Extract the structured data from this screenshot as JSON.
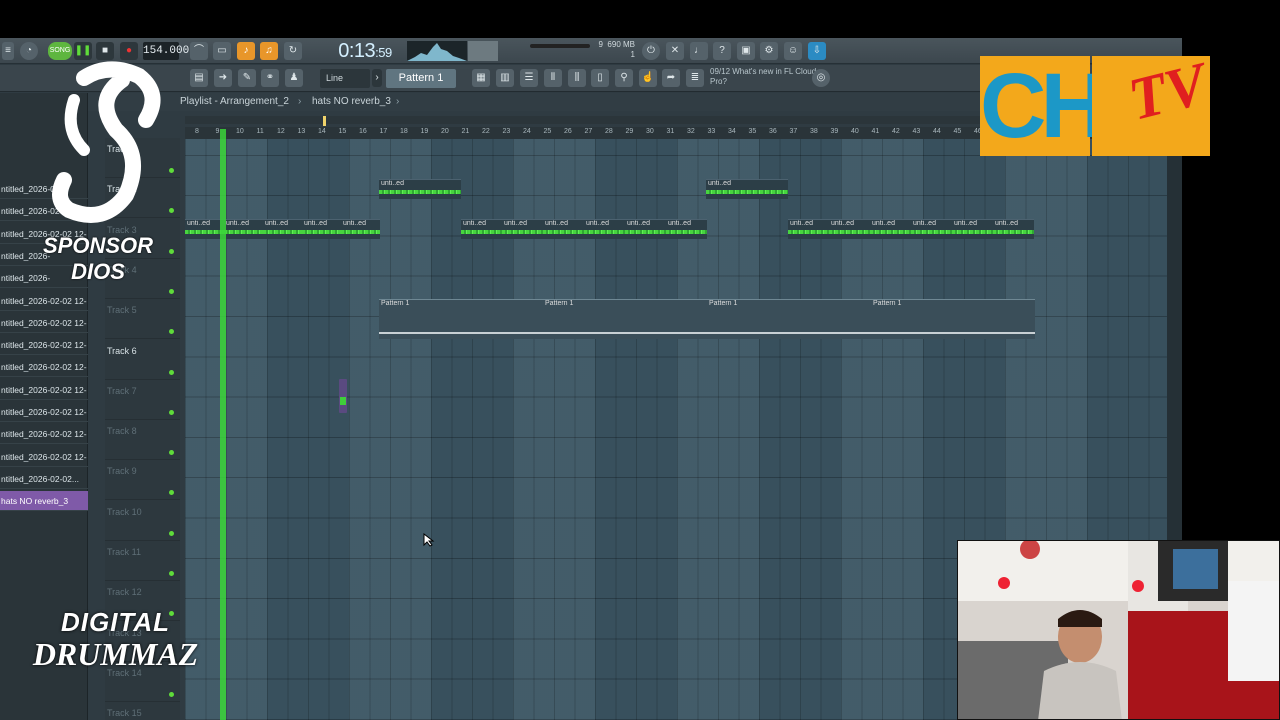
{
  "colors": {
    "accent_green": "#47d43f",
    "selection_purple": "#7f5aa8",
    "grid_bg": "#3b5563",
    "logo_orange": "#f3a81b",
    "logo_blue": "#1c98c7",
    "logo_red": "#e01f1f"
  },
  "toolbar": {
    "song_label": "SONG",
    "tempo": "154.000",
    "time_main": "0:13",
    "time_sub": "59",
    "pattern": "Pattern 1",
    "snap": "Line",
    "cpu_top": "9",
    "mem": "690 MB",
    "cpu_bottom": "1",
    "news": "09/12 What's new in FL Cloud Pro?"
  },
  "playlist": {
    "title": "Playlist - Arrangement_2",
    "crumb": "hats NO reverb_3"
  },
  "ruler": [
    "8",
    "9",
    "10",
    "11",
    "12",
    "13",
    "14",
    "15",
    "16",
    "17",
    "18",
    "19",
    "20",
    "21",
    "22",
    "23",
    "24",
    "25",
    "26",
    "27",
    "28",
    "29",
    "30",
    "31",
    "32",
    "33",
    "34",
    "35",
    "36",
    "37",
    "38",
    "39",
    "40",
    "41",
    "42",
    "43",
    "44",
    "45",
    "46"
  ],
  "browser": {
    "items": [
      "ntitled_2026-02",
      "ntitled_2026-02-02 12-",
      "ntitled_2026-02-02 12-",
      "ntitled_2026-",
      "ntitled_2026-",
      "ntitled_2026-02-02 12-",
      "ntitled_2026-02-02 12-",
      "ntitled_2026-02-02 12-",
      "ntitled_2026-02-02 12-",
      "ntitled_2026-02-02 12-",
      "ntitled_2026-02-02 12-",
      "ntitled_2026-02-02 12-",
      "ntitled_2026-02-02 12-",
      "ntitled_2026-02-02...",
      "hats NO reverb_3"
    ]
  },
  "tracks": [
    "Track 1",
    "Track 2",
    "Track 3",
    "Track 4",
    "Track 5",
    "Track 6",
    "Track 7",
    "Track 8",
    "Track 9",
    "Track 10",
    "Track 11",
    "Track 12",
    "Track 13",
    "Track 14",
    "Track 15"
  ],
  "clips": {
    "audio_label": "unti..ed",
    "pattern_label": "Pattern 1"
  },
  "overlays": {
    "sponsor_line1": "SPONSOR",
    "sponsor_line2": "DIOS",
    "brand_line1": "DIGITAL",
    "brand_line2": "DRUMMAZ",
    "logo_text": "CH",
    "logo_tv": "TV"
  }
}
